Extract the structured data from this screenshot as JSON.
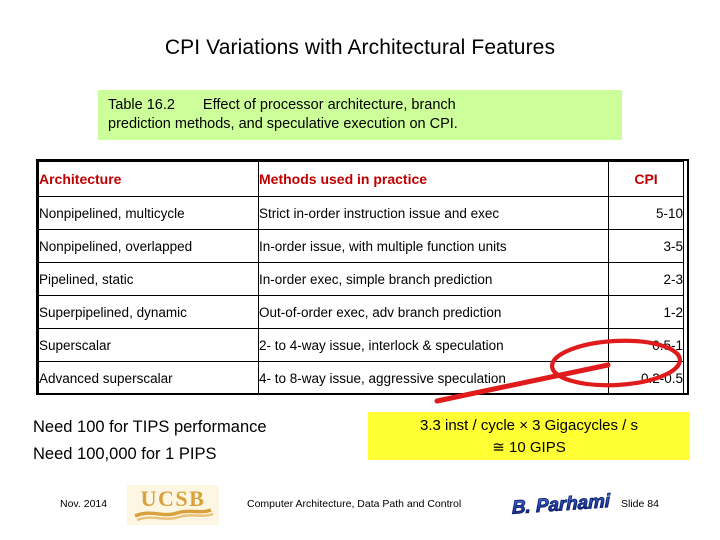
{
  "slide": {
    "title": "CPI Variations with Architectural Features"
  },
  "caption": {
    "label": "Table 16.2",
    "line1": "Effect of processor architecture, branch",
    "line2": "prediction methods, and speculative execution on CPI."
  },
  "table": {
    "headers": [
      "Architecture",
      "Methods used in practice",
      "CPI"
    ],
    "rows": [
      {
        "architecture": "Nonpipelined, multicycle",
        "methods": "Strict in-order instruction issue and exec",
        "cpi": "5-10"
      },
      {
        "architecture": "Nonpipelined, overlapped",
        "methods": "In-order issue, with multiple function units",
        "cpi": "3-5"
      },
      {
        "architecture": "Pipelined, static",
        "methods": "In-order exec, simple branch prediction",
        "cpi": "2-3"
      },
      {
        "architecture": "Superpipelined, dynamic",
        "methods": "Out-of-order exec, adv branch prediction",
        "cpi": "1-2"
      },
      {
        "architecture": "Superscalar",
        "methods": "2- to 4-way issue, interlock & speculation",
        "cpi": "0.5-1"
      },
      {
        "architecture": "Advanced superscalar",
        "methods": "4- to 8-way issue, aggressive speculation",
        "cpi": "0.2-0.5"
      }
    ]
  },
  "notes": {
    "line1": "Need 100 for TIPS performance",
    "line2": "Need 100,000 for 1 PIPS"
  },
  "gips_box": {
    "line1": "3.3  inst / cycle × 3 Gigacycles / s",
    "line2": "≅ 10 GIPS"
  },
  "annotation": {
    "color": "#e01b1b",
    "shape": "ellipse-with-pointer-line"
  },
  "footer": {
    "date": "Nov. 2014",
    "logo_left": "UCSB",
    "center": "Computer Architecture, Data Path and Control",
    "logo_right": "B. Parhami",
    "slide_number": "Slide 84"
  },
  "colors": {
    "caption_bg": "#ccff99",
    "gips_bg": "#ffff33",
    "header_text": "#c00000",
    "annotation": "#e01b1b",
    "ucsb_gold": "#d9a13b",
    "parhami_blue": "#1f3fa8"
  }
}
